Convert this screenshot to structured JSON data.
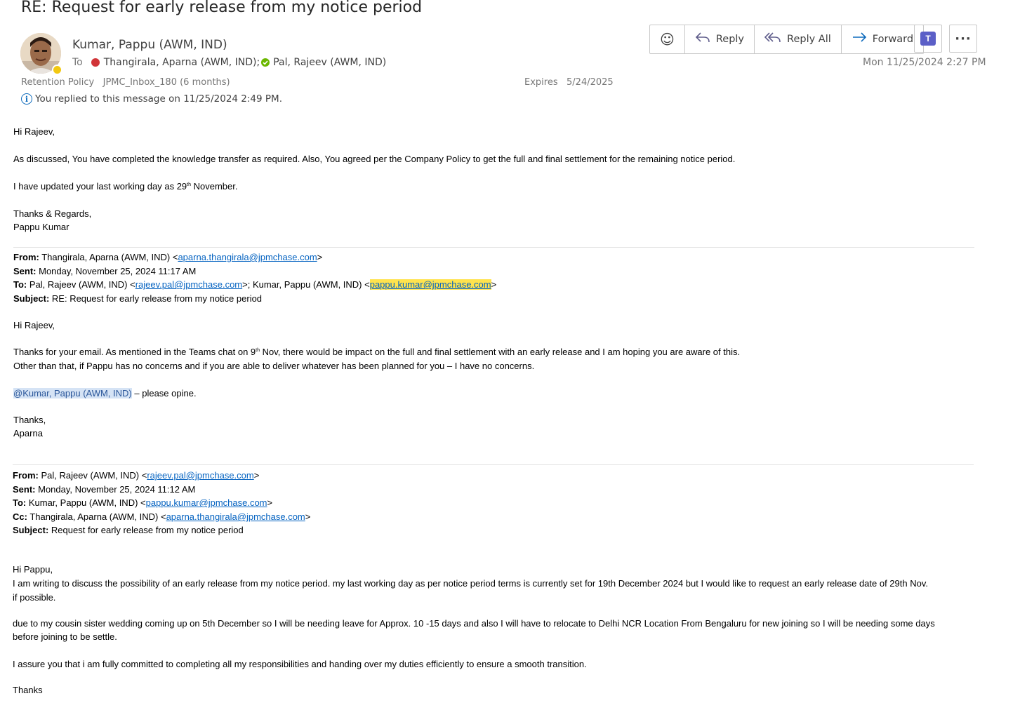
{
  "subject": "RE: Request for early release from my notice period",
  "sender": {
    "name": "Kumar, Pappu (AWM, IND)",
    "to_label": "To",
    "recipients": [
      "Thangirala, Aparna (AWM, IND);",
      "Pal, Rajeev (AWM, IND)"
    ]
  },
  "retention": {
    "label": "Retention Policy",
    "value": "JPMC_Inbox_180 (6 months)"
  },
  "expires": {
    "label": "Expires",
    "value": "5/24/2025"
  },
  "info": "You replied to this message on 11/25/2024 2:49 PM.",
  "toolbar": {
    "reply": "Reply",
    "reply_all": "Reply All",
    "forward": "Forward",
    "more": "···"
  },
  "date": "Mon 11/25/2024 2:27 PM",
  "colors": {
    "accent": "#0f6cbd",
    "presence_busy": "#d13438",
    "presence_available": "#6bb700",
    "link": "#0563c1",
    "highlight": "#ffe34d"
  },
  "icons": {
    "emoji": "smiley-icon",
    "reply": "reply-arrow-icon",
    "reply_all": "reply-all-arrow-icon",
    "forward": "forward-arrow-icon",
    "teams": "teams-icon",
    "more": "more-icon"
  },
  "msg1": {
    "greeting": "Hi Rajeev,",
    "p1": "As discussed, You have completed the knowledge transfer as required. Also, You agreed per the Company Policy to get the full and final settlement for the remaining notice period.",
    "p2_a": "I have updated your last working day as 29",
    "p2_sup": "th",
    "p2_b": " November.",
    "closing": "Thanks & Regards,",
    "signature": "Pappu Kumar"
  },
  "msg2": {
    "from_label": "From:",
    "from_name": " Thangirala, Aparna (AWM, IND) <",
    "from_email": "aparna.thangirala@jpmchase.com",
    "sent_label": "Sent:",
    "sent": " Monday, November 25, 2024 11:17 AM",
    "to_label": "To:",
    "to_name1": " Pal, Rajeev (AWM, IND) <",
    "to_email1": "rajeev.pal@jpmchase.com",
    "to_name2": ">; Kumar, Pappu (AWM, IND) <",
    "to_email2": "pappu.kumar@jpmchase.com",
    "subject_label": "Subject:",
    "subject": " RE: Request for early release from my notice period",
    "greeting": "Hi Rajeev,",
    "p1_a": "Thanks for your email. As mentioned in the Teams chat on 9",
    "p1_sup": "th",
    "p1_b": " Nov, there would be impact on the full and final settlement with an early release and I am hoping you are aware of this.",
    "p2": "Other than that, if Pappu has no concerns and if you are able to deliver whatever has been planned for you – I have no concerns.",
    "mention": "@Kumar, Pappu (AWM, IND)",
    "mention_after": " – please opine.",
    "closing": "Thanks,",
    "signature": "Aparna"
  },
  "msg3": {
    "from_label": "From:",
    "from_name": " Pal, Rajeev (AWM, IND) <",
    "from_email": "rajeev.pal@jpmchase.com",
    "sent_label": "Sent:",
    "sent": " Monday, November 25, 2024 11:12 AM",
    "to_label": "To:",
    "to_name": " Kumar, Pappu (AWM, IND) <",
    "to_email": "pappu.kumar@jpmchase.com",
    "cc_label": "Cc:",
    "cc_name": " Thangirala, Aparna (AWM, IND) <",
    "cc_email": "aparna.thangirala@jpmchase.com",
    "subject_label": "Subject:",
    "subject": " Request for early release from my notice period",
    "greeting": "Hi Pappu,",
    "p1_l1": "I am writing to discuss the possibility of an early release from my notice period. my last working day as per notice period terms is currently set for 19th December 2024 but I would like to request an early release date of 29th Nov.",
    "p1_l2": "if possible.",
    "p2_l1": "due to my cousin sister wedding coming up on 5th December so I will be needing leave for Approx. 10 -15 days and also I will have to relocate to Delhi NCR Location From Bengaluru for new joining so I will be needing some days",
    "p2_l2": "before joining to be settle.",
    "p3": "I assure you that i am fully committed  to completing all my responsibilities and handing over my duties efficiently to ensure a smooth transition.",
    "closing": "Thanks"
  }
}
